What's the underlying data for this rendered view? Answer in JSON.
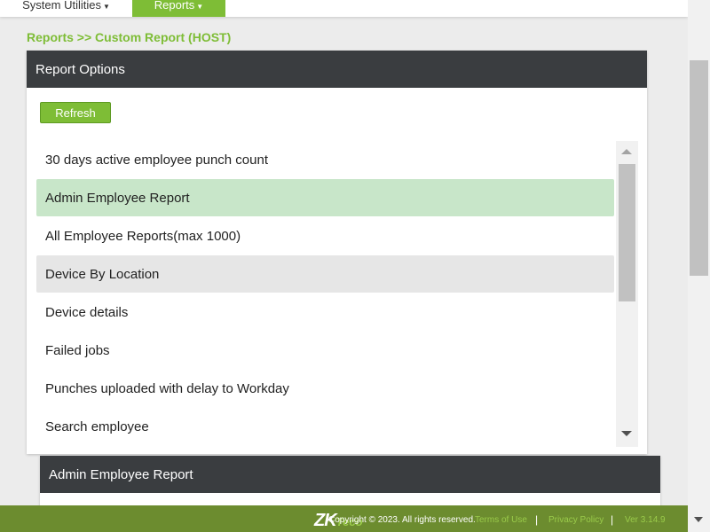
{
  "nav": {
    "system_utilities": "System Utilities",
    "reports": "Reports"
  },
  "breadcrumb": {
    "reports": "Reports",
    "sep": ">>",
    "current": "Custom Report (HOST)"
  },
  "report_options": {
    "title": "Report Options",
    "refresh_label": "Refresh",
    "items": [
      {
        "label": "30 days active employee punch count",
        "state": "normal"
      },
      {
        "label": "Admin Employee Report",
        "state": "selected"
      },
      {
        "label": "All Employee Reports(max 1000)",
        "state": "normal"
      },
      {
        "label": "Device By Location",
        "state": "hover"
      },
      {
        "label": "Device details",
        "state": "normal"
      },
      {
        "label": "Failed jobs",
        "state": "normal"
      },
      {
        "label": "Punches uploaded with delay to Workday",
        "state": "normal"
      },
      {
        "label": "Search employee",
        "state": "normal"
      }
    ]
  },
  "report_panel": {
    "title": "Admin Employee Report"
  },
  "footer": {
    "logo": "ZK",
    "logo_suffix": "Teco",
    "copyright": "Copyright © 2023. All rights reserved.",
    "terms": "Terms of Use",
    "privacy": "Privacy Policy",
    "version": "Ver 3.14.9"
  },
  "colors": {
    "accent": "#7ebd36",
    "header_dark": "#3a3d40",
    "selected_row": "#c8e6c9",
    "hover_row": "#e6e6e6",
    "footer": "#6c8c2f"
  }
}
